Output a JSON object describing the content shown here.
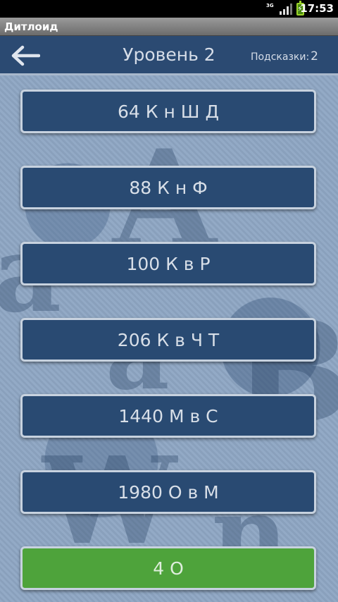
{
  "status_bar": {
    "network_label": "3G",
    "time": "17:53"
  },
  "app": {
    "title": "Дитлоид"
  },
  "header": {
    "back_icon": "arrow-left-icon",
    "level_title": "Уровень 2",
    "hints_label": "Подсказки:",
    "hints_count": "2"
  },
  "colors": {
    "header_bg": "#2b4a72",
    "item_bg": "#294a72",
    "solved_bg": "#4ea33b",
    "item_border": "#c7d2df"
  },
  "puzzles": [
    {
      "text": "64 К н Ш Д",
      "solved": false
    },
    {
      "text": "88 К н Ф",
      "solved": false
    },
    {
      "text": "100 К в Р",
      "solved": false
    },
    {
      "text": "206 К в Ч Т",
      "solved": false
    },
    {
      "text": "1440 М в С",
      "solved": false
    },
    {
      "text": "1980 О в М",
      "solved": false
    },
    {
      "text": "4 О",
      "solved": true
    }
  ]
}
